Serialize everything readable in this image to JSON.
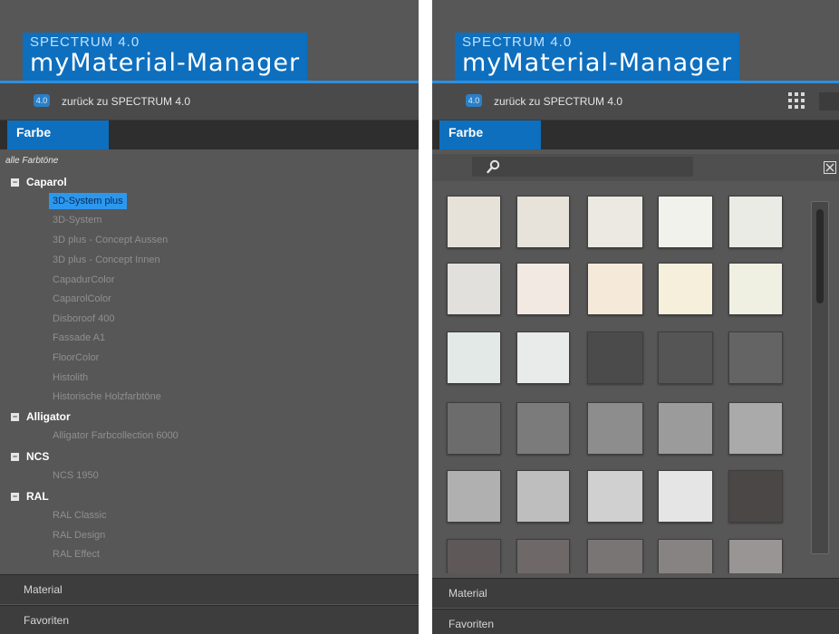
{
  "header": {
    "title_small": "SPECTRUM 4.0",
    "title_big": "myMaterial-Manager"
  },
  "back": {
    "label": "zurück zu SPECTRUM 4.0"
  },
  "tabs": {
    "active": "Farbe"
  },
  "tree": {
    "all_label": "alle Farbtöne",
    "groups": [
      {
        "name": "Caparol",
        "items": [
          "3D-System plus",
          "3D-System",
          "3D plus - Concept Aussen",
          "3D plus - Concept Innen",
          "CapadurColor",
          "CaparolColor",
          "Disboroof 400",
          "Fassade A1",
          "FloorColor",
          "Histolith",
          "Historische Holzfarbtöne"
        ]
      },
      {
        "name": "Alligator",
        "items": [
          "Alligator Farbcollection 6000"
        ]
      },
      {
        "name": "NCS",
        "items": [
          "NCS 1950"
        ]
      },
      {
        "name": "RAL",
        "items": [
          "RAL Classic",
          "RAL Design",
          "RAL Effect"
        ]
      }
    ],
    "selected": "3D-System plus"
  },
  "footer": {
    "material": "Material",
    "favoriten": "Favoriten"
  },
  "swatches": {
    "colors": [
      [
        "#e6e2da",
        "#e7e2da",
        "#ebe9e1",
        "#f1f2eb",
        "#ebebe6"
      ],
      [
        "#e1e0dd",
        "#f2e9e2",
        "#f5ead9",
        "#f6efdc",
        "#f0f0e2"
      ],
      [
        "#e2e9e6",
        "#e9eaea",
        "#4b4b4b",
        "#555555",
        "#646464"
      ],
      [
        "#6c6c6c",
        "#7b7b7b",
        "#8d8d8d",
        "#9b9b9b",
        "#aaaaaa"
      ],
      [
        "#b0b0b0",
        "#bebebe",
        "#d0d0d0",
        "#e5e5e5",
        "#4b4747"
      ],
      [
        "#5f5858",
        "#6e6868",
        "#7a7575",
        "#888383",
        "#999595"
      ]
    ]
  }
}
